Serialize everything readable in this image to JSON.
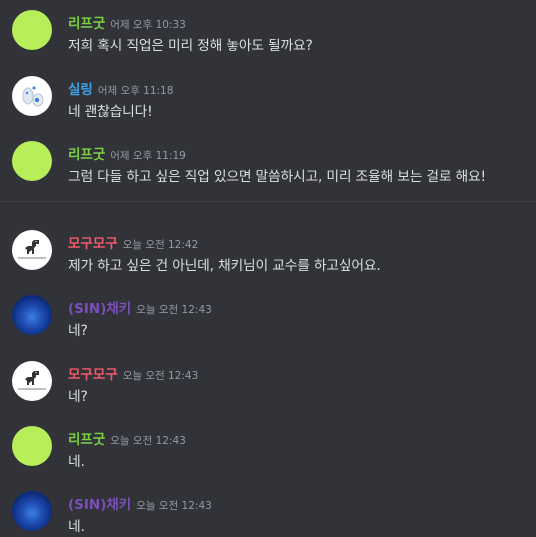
{
  "messages": [
    {
      "author": "리프굿",
      "timestamp": "어제 오후 10:33",
      "text": "저희 혹시 직업은 미리 정해 놓아도 될까요?",
      "color": "#7cd144",
      "avatar": "green"
    },
    {
      "author": "실링",
      "timestamp": "어제 오후 11:18",
      "text": "네 괜찮습니다!",
      "color": "#3fa2e6",
      "avatar": "white"
    },
    {
      "author": "리프굿",
      "timestamp": "어제 오후 11:19",
      "text": "그럼 다들 하고 싶은 직업 있으면 말씀하시고, 미리 조율해 보는 걸로 해요!",
      "color": "#7cd144",
      "avatar": "green"
    },
    {
      "author": "모구모구",
      "timestamp": "오늘 오전 12:42",
      "text": "제가 하고 싶은 건 아닌데, 채키님이 교수를 하고싶어요.",
      "color": "#f05a6b",
      "avatar": "dino"
    },
    {
      "author": "(SIN)채키",
      "timestamp": "오늘 오전 12:43",
      "text": "네?",
      "color": "#7a4fb8",
      "avatar": "blue"
    },
    {
      "author": "모구모구",
      "timestamp": "오늘 오전 12:43",
      "text": "네?",
      "color": "#f05a6b",
      "avatar": "dino"
    },
    {
      "author": "리프굿",
      "timestamp": "오늘 오전 12:43",
      "text": "네.",
      "color": "#7cd144",
      "avatar": "green"
    },
    {
      "author": "(SIN)채키",
      "timestamp": "오늘 오전 12:43",
      "text": "네.",
      "color": "#7a4fb8",
      "avatar": "blue"
    }
  ]
}
